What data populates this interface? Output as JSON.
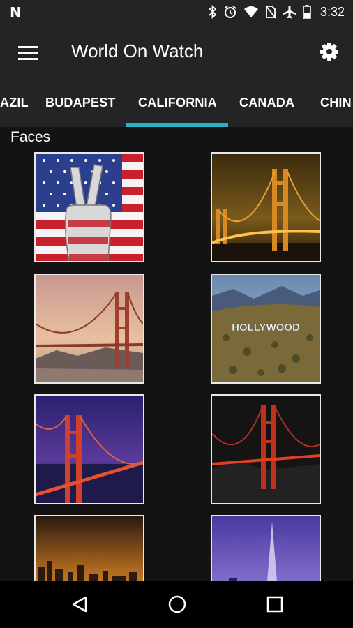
{
  "app": {
    "title": "World On Watch"
  },
  "status_bar": {
    "time": "3:32",
    "icons": [
      "n-logo-icon",
      "bluetooth-icon",
      "alarm-icon",
      "wifi-icon",
      "no-sim-icon",
      "airplane-icon",
      "battery-icon"
    ]
  },
  "tabs": [
    {
      "label": "AZIL",
      "selected": false
    },
    {
      "label": "BUDAPEST",
      "selected": false
    },
    {
      "label": "CALIFORNIA",
      "selected": true
    },
    {
      "label": "CANADA",
      "selected": false
    },
    {
      "label": "CHIN",
      "selected": false
    }
  ],
  "section": {
    "title": "Faces"
  },
  "colors": {
    "accent": "#2ab0c4",
    "app_bar": "#232426",
    "background": "#131313"
  },
  "faces": [
    {
      "subject": "usa-flag-peace-hand"
    },
    {
      "subject": "golden-gate-night-gold"
    },
    {
      "subject": "golden-gate-sunset"
    },
    {
      "subject": "hollywood-sign",
      "text": "HOLLYWOOD"
    },
    {
      "subject": "golden-gate-purple-dusk"
    },
    {
      "subject": "golden-gate-dark-night"
    },
    {
      "subject": "city-skyline-sunset"
    },
    {
      "subject": "transamerica-pyramid-dusk"
    }
  ]
}
